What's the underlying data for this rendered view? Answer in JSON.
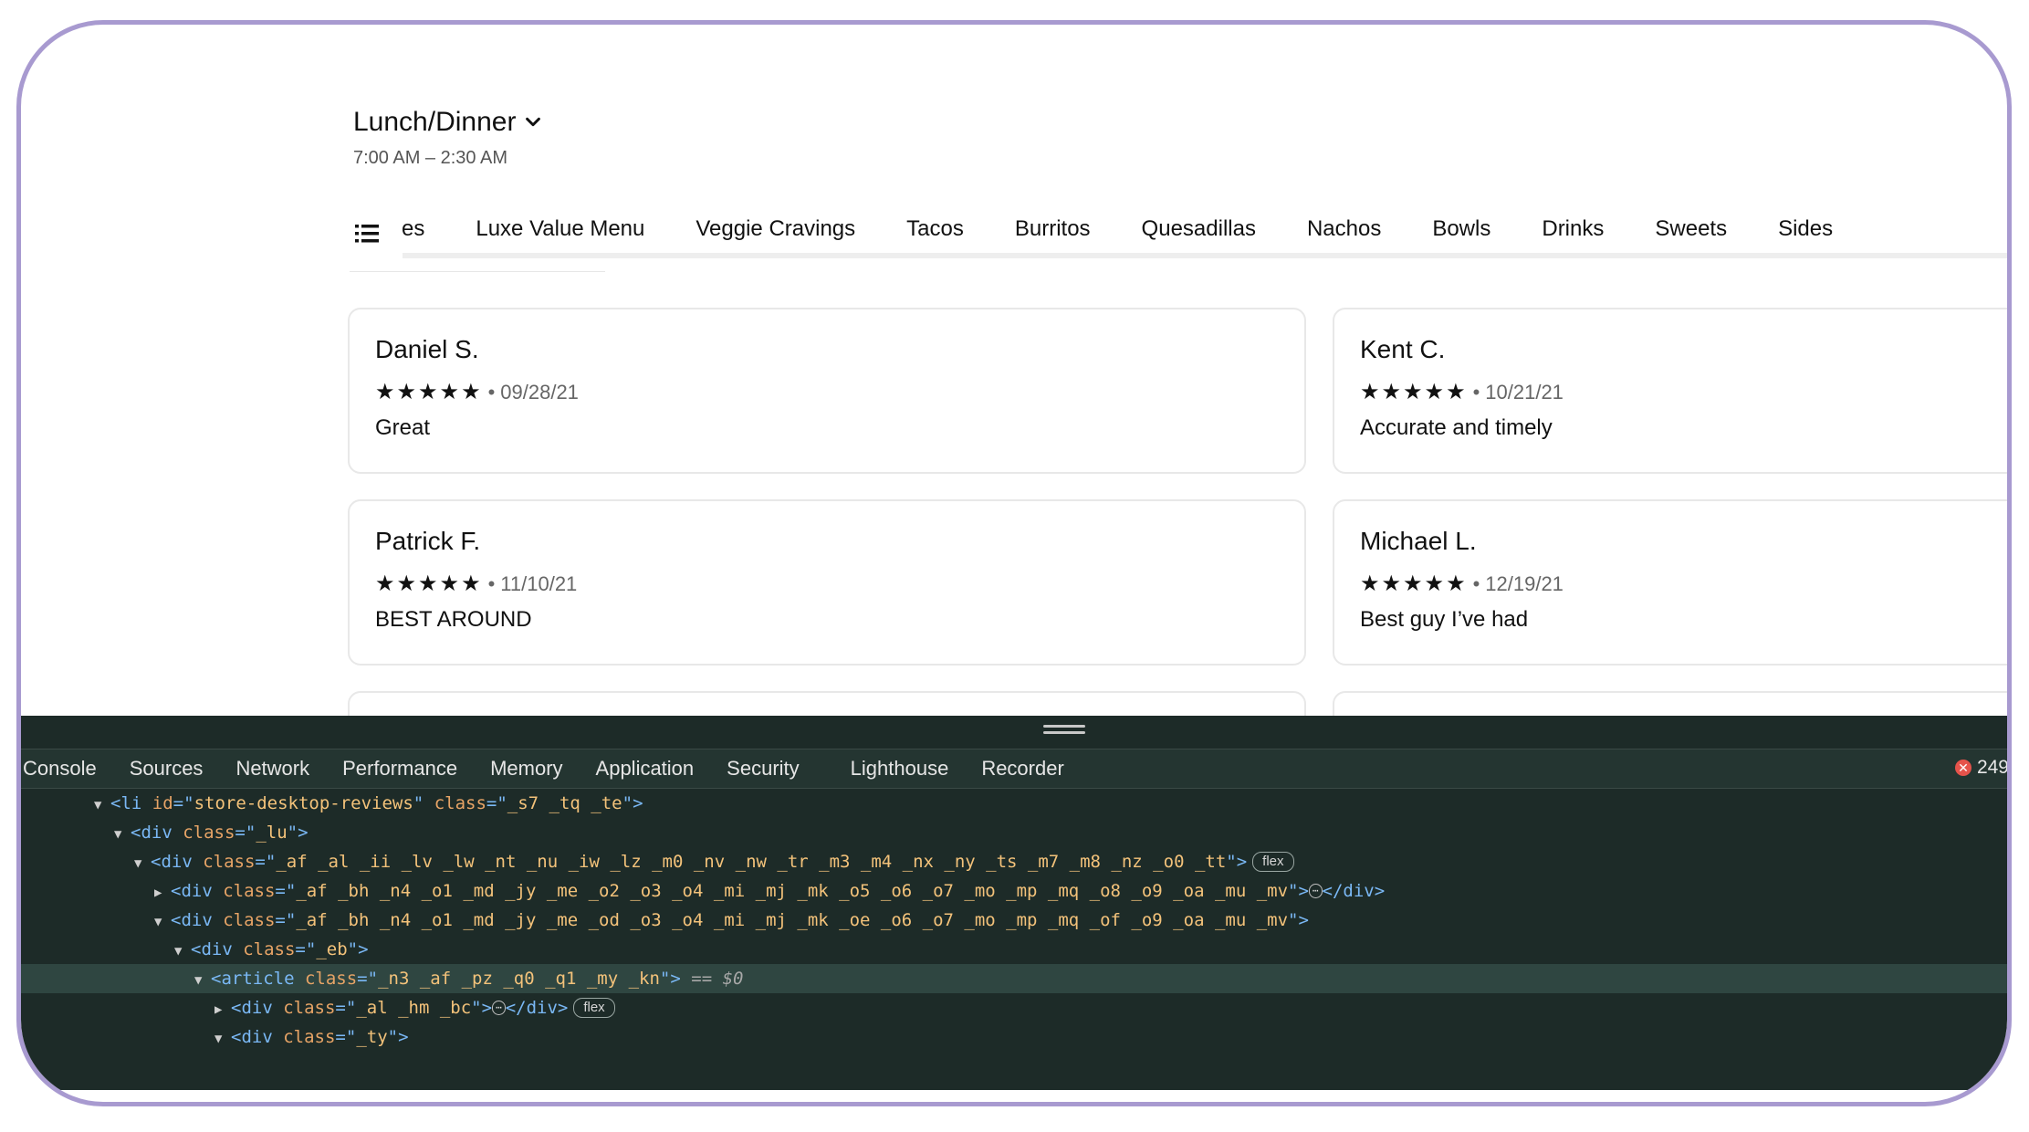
{
  "menu": {
    "title": "Lunch/Dinner",
    "hours": "7:00 AM – 2:30 AM"
  },
  "categories": [
    "es",
    "Luxe Value Menu",
    "Veggie Cravings",
    "Tacos",
    "Burritos",
    "Quesadillas",
    "Nachos",
    "Bowls",
    "Drinks",
    "Sweets",
    "Sides"
  ],
  "reviews": [
    {
      "name": "Daniel S.",
      "stars": "★★★★★",
      "date": "09/28/21",
      "text": "Great"
    },
    {
      "name": "Kent C.",
      "stars": "★★★★★",
      "date": "10/21/21",
      "text": "Accurate and timely"
    },
    {
      "name": "Patrick F.",
      "stars": "★★★★★",
      "date": "11/10/21",
      "text": "BEST AROUND"
    },
    {
      "name": "Michael L.",
      "stars": "★★★★★",
      "date": "12/19/21",
      "text": "Best guy I’ve had"
    }
  ],
  "devtools": {
    "tabs": [
      "Console",
      "Sources",
      "Network",
      "Performance",
      "Memory",
      "Application",
      "Security",
      "Lighthouse",
      "Recorder"
    ],
    "error_count": "249",
    "lines": [
      {
        "open": "▼",
        "tag": "li",
        "attrs": [
          [
            "id",
            "store-desktop-reviews"
          ],
          [
            "class",
            "_s7 _tq _te"
          ]
        ],
        "tail": ">",
        "badge": "",
        "selected": false
      },
      {
        "open": "▼",
        "tag": "div",
        "attrs": [
          [
            "class",
            "_lu"
          ]
        ],
        "tail": ">",
        "badge": "",
        "selected": false
      },
      {
        "open": "▼",
        "tag": "div",
        "attrs": [
          [
            "class",
            "_af _al _ii _lv _lw _nt _nu _iw _lz _m0 _nv _nw _tr _m3 _m4 _nx _ny _ts _m7 _m8 _nz _o0 _tt"
          ]
        ],
        "tail": ">",
        "badge": "flex",
        "selected": false
      },
      {
        "open": "▶",
        "tag": "div",
        "attrs": [
          [
            "class",
            "_af _bh _n4 _o1 _md _jy _me _o2 _o3 _o4 _mi _mj _mk _o5 _o6 _o7 _mo _mp _mq _o8 _o9 _oa _mu _mv"
          ]
        ],
        "tail": ">",
        "collapsed": true,
        "badge": "",
        "selected": false
      },
      {
        "open": "▼",
        "tag": "div",
        "attrs": [
          [
            "class",
            "_af _bh _n4 _o1 _md _jy _me _od _o3 _o4 _mi _mj _mk _oe _o6 _o7 _mo _mp _mq _of _o9 _oa _mu _mv"
          ]
        ],
        "tail": ">",
        "badge": "",
        "selected": false
      },
      {
        "open": "▼",
        "tag": "div",
        "attrs": [
          [
            "class",
            "_eb"
          ]
        ],
        "tail": ">",
        "badge": "",
        "selected": false
      },
      {
        "open": "▼",
        "tag": "article",
        "attrs": [
          [
            "class",
            "_n3 _af _pz _q0 _q1 _my _kn"
          ]
        ],
        "tail": ">",
        "badge": "",
        "selected": true,
        "suffix": "== $0"
      },
      {
        "open": "▶",
        "tag": "div",
        "attrs": [
          [
            "class",
            "_al _hm _bc"
          ]
        ],
        "tail": ">",
        "collapsed": true,
        "badge": "flex",
        "selected": false
      },
      {
        "open": "▼",
        "tag": "div",
        "attrs": [
          [
            "class",
            "_ty"
          ]
        ],
        "tail": ">",
        "badge": "",
        "selected": false
      }
    ]
  }
}
